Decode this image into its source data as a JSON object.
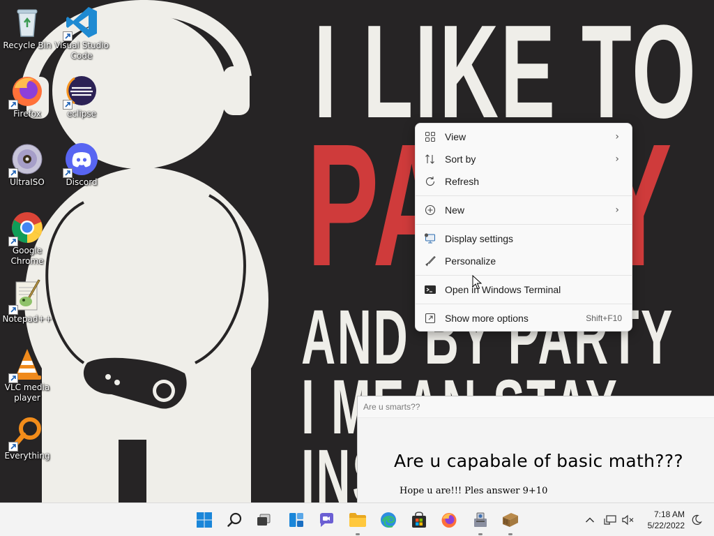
{
  "desktop": {
    "icons": [
      {
        "label": "Recycle Bin",
        "icon": "recycle-bin-icon"
      },
      {
        "label": "Visual Studio Code",
        "icon": "vscode-icon"
      },
      {
        "label": "Firefox",
        "icon": "firefox-icon"
      },
      {
        "label": "eclipse",
        "icon": "eclipse-icon"
      },
      {
        "label": "UltraISO",
        "icon": "ultraiso-icon"
      },
      {
        "label": "Discord",
        "icon": "discord-icon"
      },
      {
        "label": "Google Chrome",
        "icon": "chrome-icon"
      },
      {
        "label": "Notepad++",
        "icon": "notepadpp-icon"
      },
      {
        "label": "VLC media player",
        "icon": "vlc-icon"
      },
      {
        "label": "Everything",
        "icon": "everything-icon"
      }
    ]
  },
  "wallpaper": {
    "lines": [
      "I LIKE TO",
      "PARTY",
      "AND BY PARTY",
      "I MEAN STAY",
      "INS"
    ]
  },
  "context_menu": {
    "items": [
      {
        "label": "View",
        "icon": "view-grid-icon",
        "submenu": true
      },
      {
        "label": "Sort by",
        "icon": "sort-icon",
        "submenu": true
      },
      {
        "label": "Refresh",
        "icon": "refresh-icon",
        "submenu": false
      },
      {
        "label": "New",
        "icon": "new-plus-icon",
        "submenu": true
      },
      {
        "label": "Display settings",
        "icon": "display-icon",
        "submenu": false
      },
      {
        "label": "Personalize",
        "icon": "brush-icon",
        "submenu": false
      },
      {
        "label": "Open in Windows Terminal",
        "icon": "terminal-icon",
        "submenu": false
      },
      {
        "label": "Show more options",
        "icon": "more-options-icon",
        "shortcut": "Shift+F10"
      }
    ]
  },
  "popup": {
    "title": "Are u smarts??",
    "heading": "Are u capabale of basic math???",
    "subtext": "Hope u are!!! Ples answer 9+10"
  },
  "taskbar": {
    "apps": [
      "start-icon",
      "search-icon",
      "task-view-icon",
      "widgets-icon",
      "chat-icon",
      "file-explorer-icon",
      "edge-icon",
      "store-icon",
      "firefox-icon",
      "app-icon",
      "app2-icon"
    ],
    "time": "7:18 AM",
    "date": "5/22/2022"
  },
  "colors": {
    "wallpaper_bg": "#262425",
    "wallpaper_red": "#cf3b3b",
    "menu_bg": "#f9f9f9",
    "taskbar_bg": "#f3f3f3"
  }
}
